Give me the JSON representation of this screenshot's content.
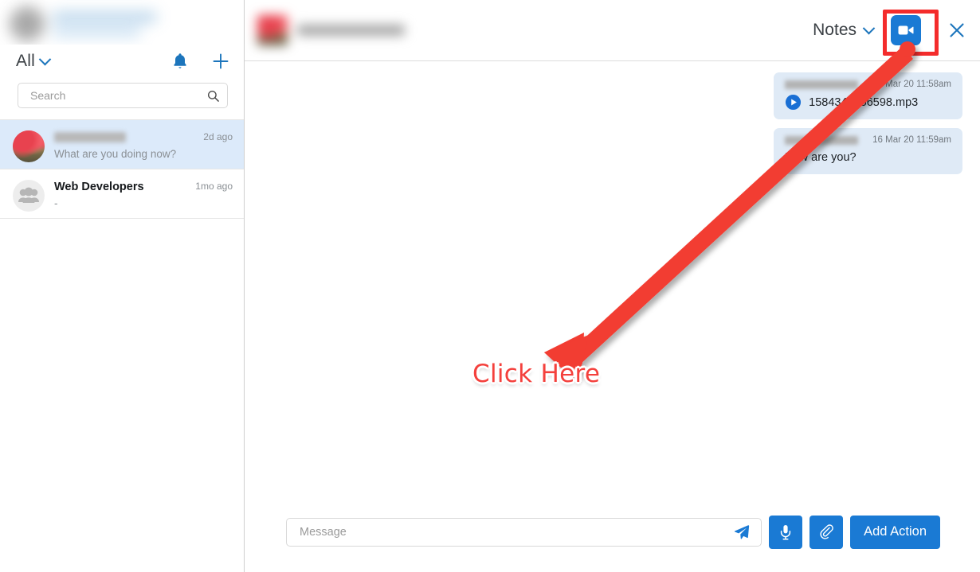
{
  "sidebar": {
    "header": {
      "blurred": true,
      "avatar_icon": "user-avatar"
    },
    "filter": {
      "label": "All",
      "chevron_icon": "chevron-down-icon"
    },
    "notifications_icon": "bell-icon",
    "add_icon": "plus-icon",
    "search": {
      "placeholder": "Search",
      "value": "",
      "icon": "search-icon"
    },
    "conversations": [
      {
        "name": "",
        "name_blurred": true,
        "snippet": "What are you doing now?",
        "time": "2d ago",
        "avatar_type": "photo",
        "selected": true
      },
      {
        "name": "Web Developers",
        "name_blurred": false,
        "snippet": "-",
        "time": "1mo ago",
        "avatar_type": "group",
        "selected": false
      }
    ]
  },
  "chat": {
    "header": {
      "contact_name": "",
      "contact_name_blurred": true,
      "avatar_icon": "contact-avatar",
      "notes_label": "Notes",
      "notes_chevron_icon": "chevron-down-icon",
      "video_call_icon": "video-camera-icon",
      "close_icon": "close-icon"
    },
    "messages": [
      {
        "sender": "",
        "sender_blurred": true,
        "time": "16 Mar 20 11:58am",
        "type": "audio",
        "file_name": "1584340156598.mp3",
        "play_icon": "play-icon"
      },
      {
        "sender": "",
        "sender_blurred": true,
        "time": "16 Mar 20 11:59am",
        "type": "text",
        "text": "How are you?"
      }
    ],
    "composer": {
      "placeholder": "Message",
      "value": "",
      "send_icon": "send-icon",
      "mic_icon": "microphone-icon",
      "attach_icon": "paperclip-icon",
      "add_action_label": "Add Action"
    }
  },
  "annotation": {
    "click_here_label": "Click Here",
    "arrow_color": "#f23c33",
    "highlight_color": "#f42c2c"
  },
  "colors": {
    "accent_blue": "#1a7ad4",
    "selected_row": "#dceafa",
    "bubble_blue": "#dfeaf6",
    "annotation_red": "#f4403c"
  }
}
